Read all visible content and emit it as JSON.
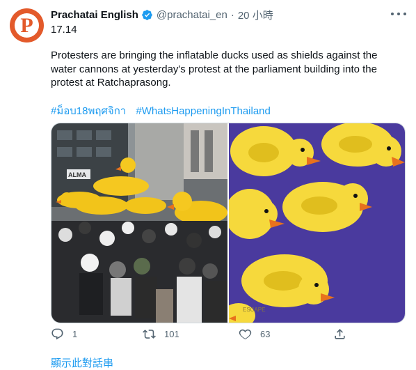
{
  "tweet": {
    "avatar_letter": "P",
    "author_name": "Prachatai English",
    "handle": "@prachatai_en",
    "separator": "·",
    "time": "20 小時",
    "first_line": "17.14",
    "text": "Protesters are bringing the inflatable ducks used as shields against the water cannons at yesterday's protest at the parliament building into the protest at Ratchaprasong.",
    "hashtags": [
      "#ม็อบ18พฤศจิกา",
      "#WhatsHappeningInThailand"
    ],
    "media": [
      {
        "icon": "protest-crowd-photo",
        "overlay": "ALMA"
      },
      {
        "icon": "inflatable-ducks-photo",
        "overlay": "ESCAPE"
      }
    ],
    "actions": {
      "reply_count": "1",
      "retweet_count": "101",
      "like_count": "63"
    },
    "show_thread": "顯示此對話串"
  },
  "colors": {
    "avatar": "#e35a2b",
    "link": "#1d9bf0",
    "muted": "#536471",
    "duck_yellow": "#f6d93c",
    "background_purple": "#4a3a9e"
  }
}
